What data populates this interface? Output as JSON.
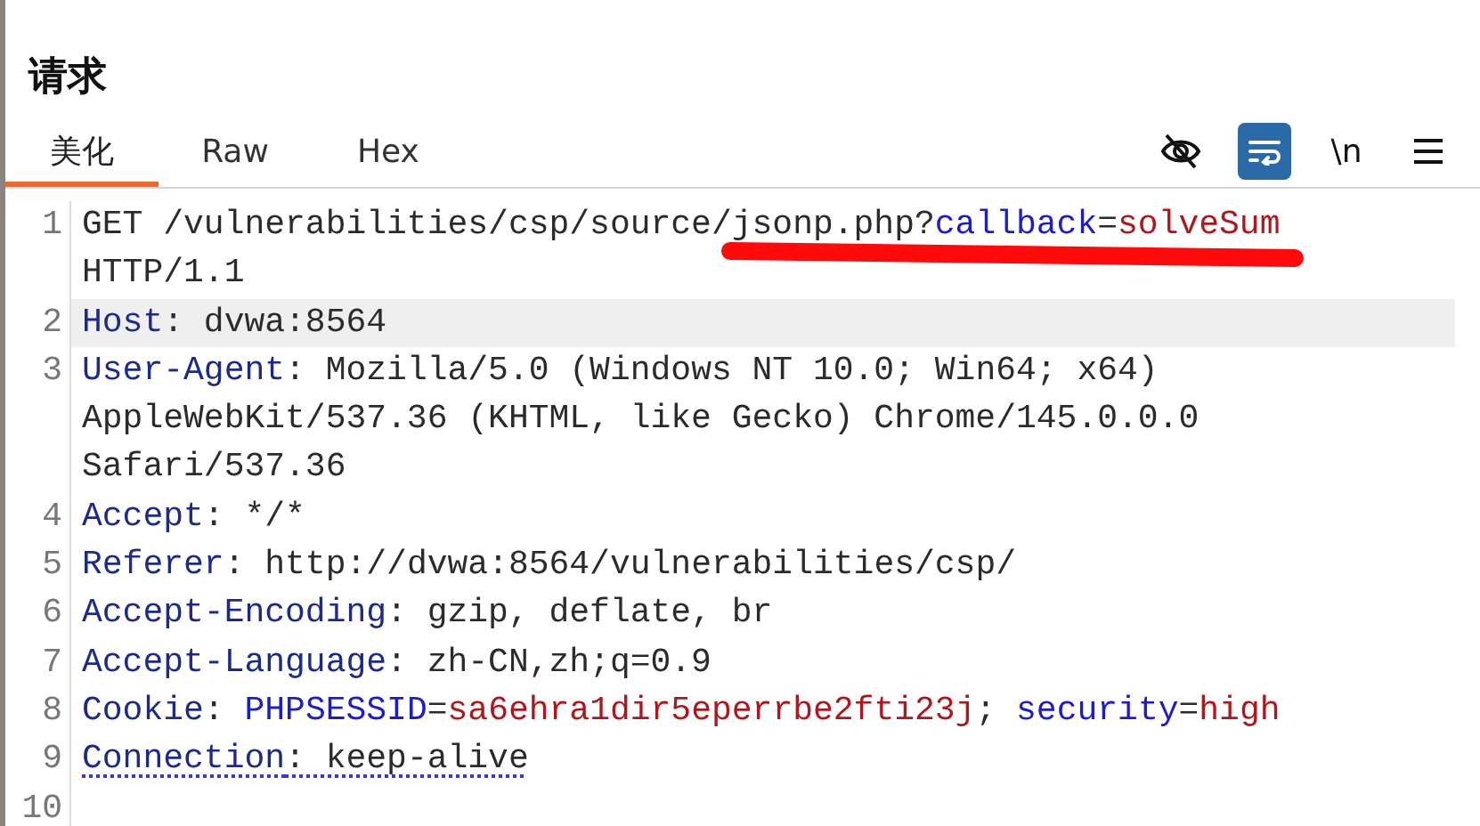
{
  "panel": {
    "title": "请求"
  },
  "tabs": [
    {
      "label": "美化",
      "selected": true
    },
    {
      "label": "Raw",
      "selected": false
    },
    {
      "label": "Hex",
      "selected": false
    }
  ],
  "toolbar": [
    {
      "kind": "hide",
      "on": false
    },
    {
      "kind": "wrap",
      "on": true
    },
    {
      "kind": "newline",
      "label": "\\n",
      "on": false
    },
    {
      "kind": "menu",
      "on": false
    }
  ],
  "lines": [
    {
      "number": "1",
      "highlighted": false,
      "underlined": false,
      "rows": [
        [
          {
            "kind": "plain",
            "text": "GET /vulnerabilities/csp/source/jsonp.php?"
          },
          {
            "kind": "param-name",
            "text": "callback"
          },
          {
            "kind": "plain",
            "text": "="
          },
          {
            "kind": "param-value",
            "text": "solveSum"
          }
        ],
        [
          {
            "kind": "plain",
            "text": "HTTP/1.1"
          }
        ]
      ]
    },
    {
      "number": "2",
      "highlighted": true,
      "underlined": false,
      "rows": [
        [
          {
            "kind": "header-name",
            "text": "Host"
          },
          {
            "kind": "plain",
            "text": ": dvwa:8564"
          }
        ]
      ]
    },
    {
      "number": "3",
      "highlighted": false,
      "underlined": false,
      "rows": [
        [
          {
            "kind": "header-name",
            "text": "User-Agent"
          },
          {
            "kind": "plain",
            "text": ": Mozilla/5.0 (Windows NT 10.0; Win64; x64)"
          }
        ],
        [
          {
            "kind": "plain",
            "text": "AppleWebKit/537.36 (KHTML, like Gecko) Chrome/145.0.0.0"
          }
        ],
        [
          {
            "kind": "plain",
            "text": "Safari/537.36"
          }
        ]
      ]
    },
    {
      "number": "4",
      "highlighted": false,
      "underlined": false,
      "rows": [
        [
          {
            "kind": "header-name",
            "text": "Accept"
          },
          {
            "kind": "plain",
            "text": ": */*"
          }
        ]
      ]
    },
    {
      "number": "5",
      "highlighted": false,
      "underlined": false,
      "rows": [
        [
          {
            "kind": "header-name",
            "text": "Referer"
          },
          {
            "kind": "plain",
            "text": ": http://dvwa:8564/vulnerabilities/csp/"
          }
        ]
      ]
    },
    {
      "number": "6",
      "highlighted": false,
      "underlined": false,
      "rows": [
        [
          {
            "kind": "header-name",
            "text": "Accept-Encoding"
          },
          {
            "kind": "plain",
            "text": ": gzip, deflate, br"
          }
        ]
      ]
    },
    {
      "number": "7",
      "highlighted": false,
      "underlined": false,
      "rows": [
        [
          {
            "kind": "header-name",
            "text": "Accept-Language"
          },
          {
            "kind": "plain",
            "text": ": zh-CN,zh;q=0.9"
          }
        ]
      ]
    },
    {
      "number": "8",
      "highlighted": false,
      "underlined": false,
      "rows": [
        [
          {
            "kind": "header-name",
            "text": "Cookie"
          },
          {
            "kind": "plain",
            "text": ": "
          },
          {
            "kind": "param-name",
            "text": "PHPSESSID"
          },
          {
            "kind": "plain",
            "text": "="
          },
          {
            "kind": "param-value",
            "text": "sa6ehra1dir5eperrbe2fti23j"
          },
          {
            "kind": "plain",
            "text": "; "
          },
          {
            "kind": "param-name",
            "text": "security"
          },
          {
            "kind": "plain",
            "text": "="
          },
          {
            "kind": "param-value",
            "text": "high"
          }
        ]
      ]
    },
    {
      "number": "9",
      "highlighted": false,
      "underlined": true,
      "rows": [
        [
          {
            "kind": "header-name",
            "text": "Connection"
          },
          {
            "kind": "plain",
            "text": ": keep-alive"
          }
        ]
      ]
    },
    {
      "number": "10",
      "highlighted": false
    }
  ]
}
